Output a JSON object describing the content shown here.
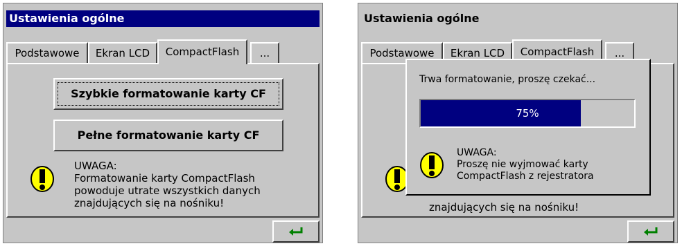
{
  "left": {
    "title": "Ustawienia ogólne",
    "tabs": [
      "Podstawowe",
      "Ekran LCD",
      "CompactFlash",
      "..."
    ],
    "selected_tab": "CompactFlash",
    "buttons": {
      "quick_format": "Szybkie formatowanie karty CF",
      "full_format": "Pełne formatowanie karty CF"
    },
    "warning": {
      "heading": "UWAGA:",
      "lines": [
        "Formatowanie karty CompactFlash",
        "powoduje utrate wszystkich danych",
        "znajdujących się na nośniku!"
      ]
    },
    "enter_icon": "enter-arrow-icon"
  },
  "right": {
    "title": "Ustawienia ogólne",
    "tabs": [
      "Podstawowe",
      "Ekran LCD",
      "CompactFlash",
      "..."
    ],
    "selected_tab": "CompactFlash",
    "behind_text": "znajdujących się na nośniku!",
    "dialog": {
      "message": "Trwa formatowanie, proszę czekać...",
      "progress": 75,
      "progress_label": "75%",
      "warning_lines": [
        "UWAGA:",
        "Proszę nie wyjmować karty",
        "CompactFlash z rejestratora"
      ]
    },
    "enter_icon": "enter-arrow-icon"
  },
  "colors": {
    "title_active": "#000080",
    "face": "#c6c6c6",
    "progress_fill": "#000080",
    "warning_yellow": "#ffff00"
  }
}
